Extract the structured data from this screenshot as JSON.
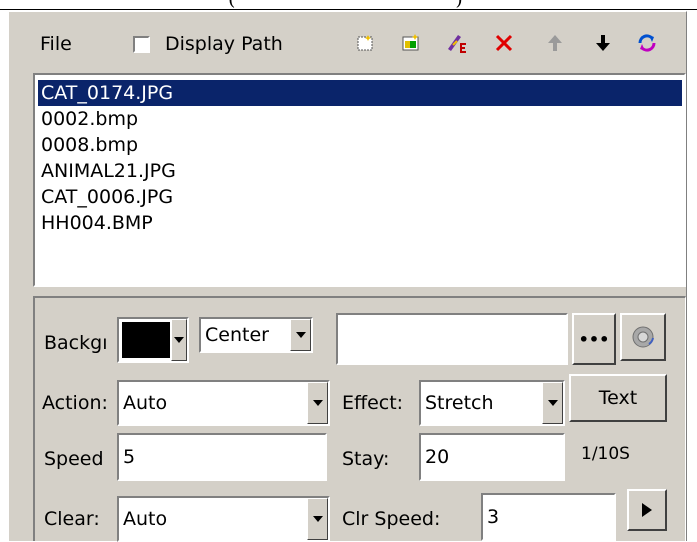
{
  "header_fragment": {
    "text": "(",
    "text2": "s",
    "link": "",
    "close": ")"
  },
  "toolbar": {
    "file_label": "File",
    "display_path_label": "Display Path",
    "display_path_checked": false,
    "icons": [
      "new-list-icon",
      "add-files-icon",
      "edit-icon",
      "delete-icon",
      "move-up-icon",
      "move-down-icon",
      "refresh-icon"
    ]
  },
  "files": [
    {
      "name": "CAT_0174.JPG",
      "selected": true
    },
    {
      "name": "0002.bmp",
      "selected": false
    },
    {
      "name": "0008.bmp",
      "selected": false
    },
    {
      "name": "ANIMAL21.JPG",
      "selected": false
    },
    {
      "name": "CAT_0006.JPG",
      "selected": false
    },
    {
      "name": "HH004.BMP",
      "selected": false
    }
  ],
  "settings": {
    "background_label": "Backgı",
    "background_color": "#000000",
    "position_value": "Center",
    "path_value": "",
    "browse_label": "•••",
    "action_label": "Action:",
    "action_value": "Auto",
    "effect_label": "Effect:",
    "effect_value": "Stretch",
    "text_button_label": "Text",
    "speed_label": "Speed",
    "speed_value": "5",
    "stay_label": "Stay:",
    "stay_value": "20",
    "stay_unit": "1/10S",
    "clear_label": "Clear:",
    "clear_value": "Auto",
    "clr_speed_label": "Clr Speed:",
    "clr_speed_value": "3"
  }
}
